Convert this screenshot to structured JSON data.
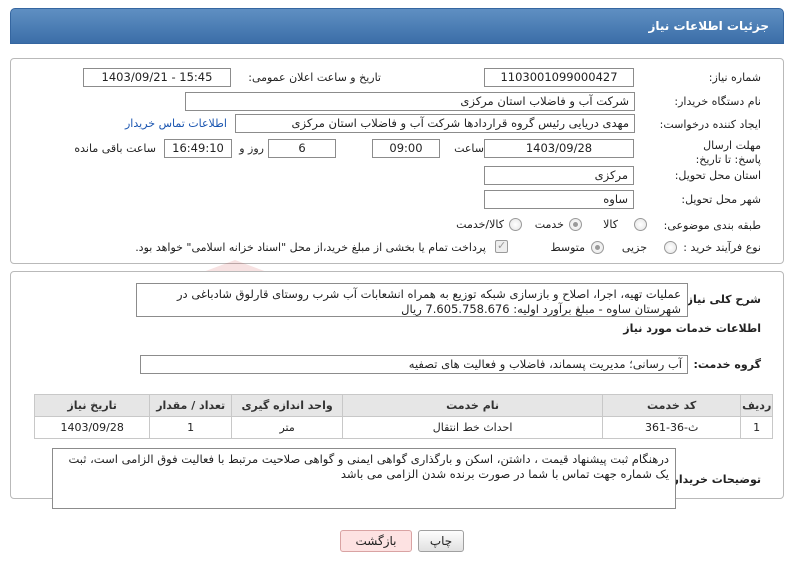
{
  "title": "جزئیات اطلاعات نیاز",
  "labels": {
    "need_number": "شماره نیاز:",
    "announce_datetime": "تاریخ و ساعت اعلان عمومی:",
    "buyer_org": "نام دستگاه خریدار:",
    "creator": "ایجاد کننده درخواست:",
    "contact_link": "اطلاعات تماس خریدار",
    "deadline": "مهلت ارسال پاسخ: تا تاریخ:",
    "time_word": "ساعت",
    "days_word": "روز و",
    "remaining_word": "ساعت باقی مانده",
    "province": "استان محل تحویل:",
    "city": "شهر محل تحویل:",
    "category": "طبقه بندی موضوعی:",
    "process_type": "نوع فرآیند خرید :",
    "general_desc": "شرح کلی نیاز:",
    "services_info": "اطلاعات خدمات مورد نیاز",
    "service_group": "گروه خدمت:",
    "buyer_notes": "توضیحات خریدار:"
  },
  "values": {
    "need_number": "1103001099000427",
    "announce_datetime": "1403/09/21 - 15:45",
    "buyer_org": "شرکت آب و فاضلاب استان مرکزی",
    "creator": "مهدی دریایی رئیس گروه قراردادها شرکت آب و فاضلاب استان مرکزی",
    "deadline_date": "1403/09/28",
    "deadline_time": "09:00",
    "days_remaining": "6",
    "time_remaining": "16:49:10",
    "province": "مرکزی",
    "city": "ساوه"
  },
  "category_options": [
    "کالا",
    "خدمت",
    "کالا/خدمت"
  ],
  "category_selected": "خدمت",
  "process_options": [
    "جزیی",
    "متوسط"
  ],
  "process_selected": "متوسط",
  "payment_note": "پرداخت تمام یا بخشی از مبلغ خرید،از محل \"اسناد خزانه اسلامی\" خواهد بود.",
  "general_desc_text": "عملیات تهیه، اجرا، اصلاح و بازسازی شبکه توزیع به همراه انشعابات آب شرب روستای قارلوق شادباغی در شهرستان ساوه - مبلغ برآورد اولیه: 7.605.758.676 ریال",
  "service_group_value": "آب رسانی؛ مدیریت پسماند، فاضلاب و فعالیت های تصفیه",
  "table": {
    "headers": [
      "ردیف",
      "کد خدمت",
      "نام خدمت",
      "واحد اندازه گیری",
      "تعداد / مقدار",
      "تاریخ نیاز"
    ],
    "rows": [
      [
        "1",
        "ث-36-361",
        "احداث خط انتقال",
        "متر",
        "1",
        "1403/09/28"
      ]
    ]
  },
  "buyer_notes_text": "درهنگام ثبت پیشنهاد قیمت ، داشتن، اسکن و بارگذاری گواهی ایمنی و گواهی صلاحیت مرتبط با فعالیت فوق الزامی است، ثبت یک شماره جهت تماس با شما در صورت برنده شدن الزامی می باشد",
  "buttons": {
    "print": "چاپ",
    "back": "بازگشت"
  },
  "watermark_text": "AriaTender.neT",
  "colors": {
    "title_bar": "#3b6ea8",
    "link": "#1a55b0",
    "back_button": "#fde2e2"
  }
}
